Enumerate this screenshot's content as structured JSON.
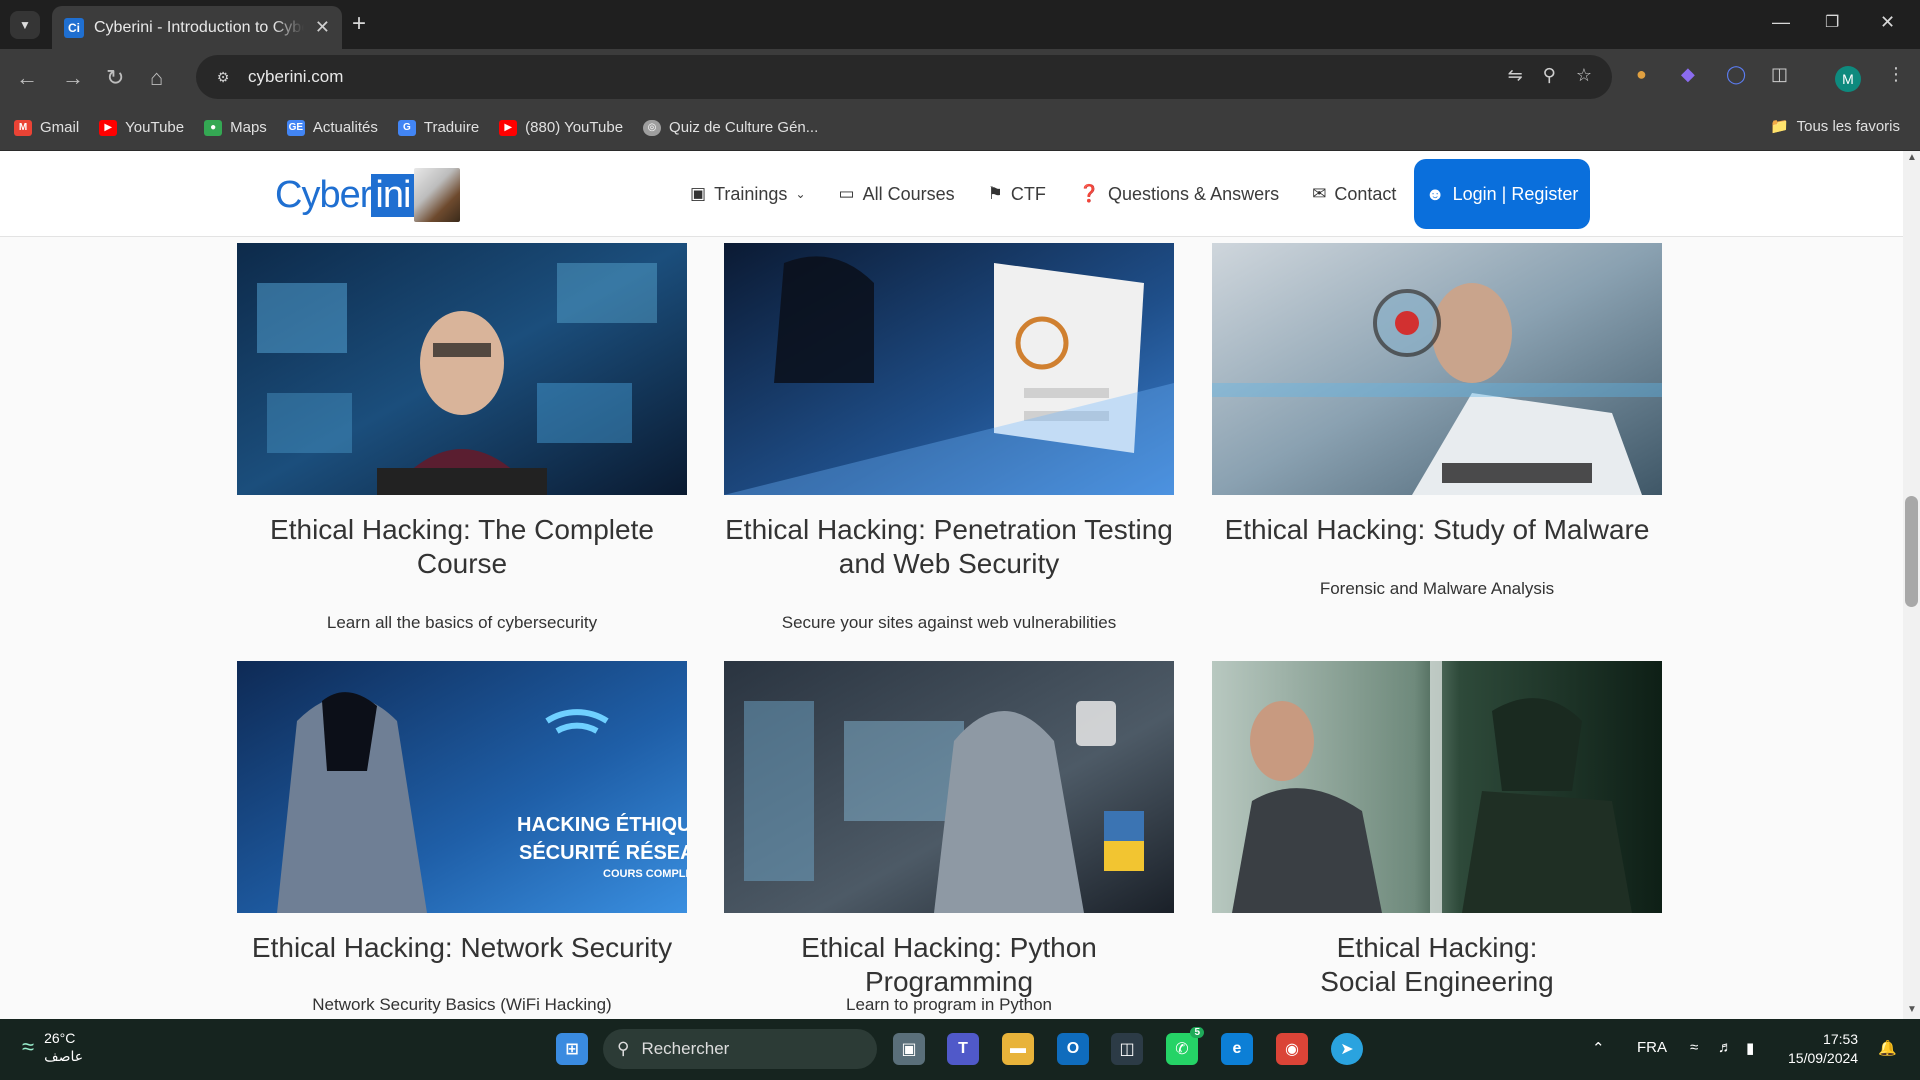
{
  "browser": {
    "tab_title": "Cyberini - Introduction to Cybersecurity",
    "favicon_text": "Ci",
    "url": "cyberini.com",
    "bookmarks": [
      {
        "label": "Gmail",
        "color": "#ea4335"
      },
      {
        "label": "YouTube",
        "color": "#ff0000"
      },
      {
        "label": "Maps",
        "color": "#34a853"
      },
      {
        "label": "Actualités",
        "color": "#4285f4"
      },
      {
        "label": "Traduire",
        "color": "#4285f4"
      },
      {
        "label": "(880) YouTube",
        "color": "#ff0000"
      },
      {
        "label": "Quiz de Culture Gén...",
        "color": "#9e9e9e"
      }
    ],
    "all_bookmarks": "Tous les favoris",
    "profile_initial": "M"
  },
  "site": {
    "logo_part1": "Cyber",
    "logo_part2": "ini",
    "menu": {
      "trainings": "Trainings",
      "all_courses": "All Courses",
      "ctf": "CTF",
      "qa": "Questions & Answers",
      "contact": "Contact",
      "login": "Login | Register"
    },
    "courses": [
      {
        "title": "Ethical Hacking: The Complete Course",
        "description": "Learn all the basics of cybersecurity"
      },
      {
        "title": "Ethical Hacking: Penetration Testing and Web Security",
        "description": "Secure your sites against web vulnerabilities"
      },
      {
        "title": "Ethical Hacking: Study of Malware",
        "description": "Forensic and Malware Analysis"
      },
      {
        "title": "Ethical Hacking: Network Security",
        "description": "Network Security Basics (WiFi Hacking)",
        "image_caption_1": "HACKING ÉTHIQUE",
        "image_caption_2": "SÉCURITÉ RÉSEAU",
        "image_caption_3": "COURS COMPLET"
      },
      {
        "title": "Ethical Hacking: Python Programming",
        "description": "Learn to program in Python"
      },
      {
        "title": "Ethical Hacking: Social Engineering",
        "description": ""
      }
    ]
  },
  "taskbar": {
    "temperature": "26°C",
    "weather_desc": "عاصف",
    "search_placeholder": "Rechercher",
    "language": "FRA",
    "time": "17:53",
    "date": "15/09/2024",
    "whatsapp_badge": "5"
  }
}
